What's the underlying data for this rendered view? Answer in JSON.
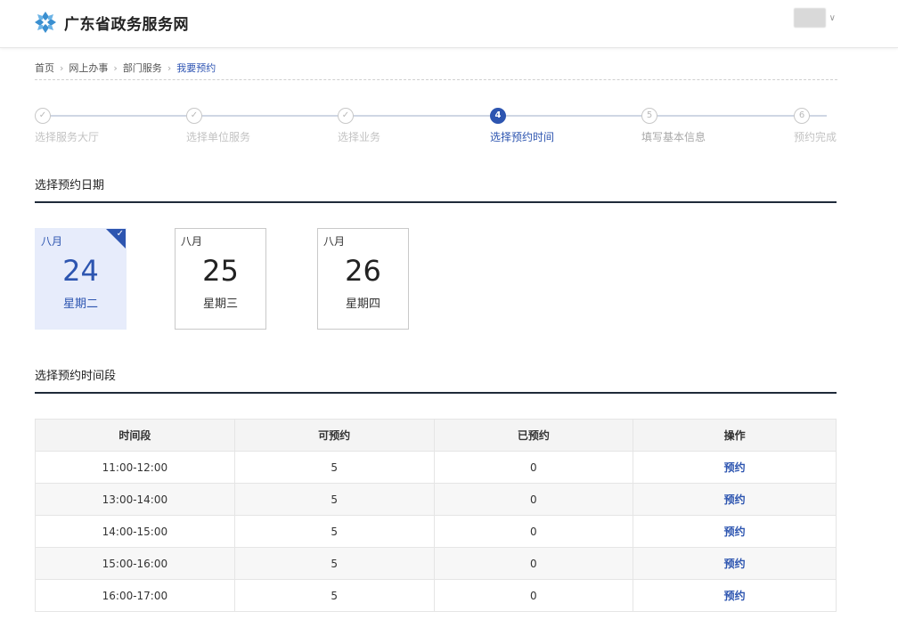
{
  "header": {
    "site_title": "广东省政务服务网",
    "logo_icon": "snowflake-logo-icon",
    "user_menu_icon": "chevron-down-icon"
  },
  "breadcrumb": {
    "items": [
      "首页",
      "网上办事",
      "部门服务",
      "我要预约"
    ]
  },
  "steps": [
    {
      "label": "选择服务大厅",
      "state": "done"
    },
    {
      "label": "选择单位服务",
      "state": "done"
    },
    {
      "label": "选择业务",
      "state": "done"
    },
    {
      "label": "选择预约时间",
      "state": "active",
      "number": "4"
    },
    {
      "label": "填写基本信息",
      "state": "pending",
      "number": "5"
    },
    {
      "label": "预约完成",
      "state": "pending",
      "number": "6"
    }
  ],
  "date_section": {
    "title": "选择预约日期",
    "dates": [
      {
        "month": "八月",
        "day": "24",
        "weekday": "星期二",
        "selected": true
      },
      {
        "month": "八月",
        "day": "25",
        "weekday": "星期三",
        "selected": false
      },
      {
        "month": "八月",
        "day": "26",
        "weekday": "星期四",
        "selected": false
      }
    ]
  },
  "time_section": {
    "title": "选择预约时间段",
    "columns": [
      "时间段",
      "可预约",
      "已预约",
      "操作"
    ],
    "rows": [
      {
        "time": "11:00-12:00",
        "available": "5",
        "booked": "0",
        "action": "预约"
      },
      {
        "time": "13:00-14:00",
        "available": "5",
        "booked": "0",
        "action": "预约"
      },
      {
        "time": "14:00-15:00",
        "available": "5",
        "booked": "0",
        "action": "预约"
      },
      {
        "time": "15:00-16:00",
        "available": "5",
        "booked": "0",
        "action": "预约"
      },
      {
        "time": "16:00-17:00",
        "available": "5",
        "booked": "0",
        "action": "预约"
      }
    ]
  },
  "colors": {
    "accent": "#2d55b0",
    "selected_bg": "#e7ecfb",
    "done_step": "#c3c3c3"
  }
}
